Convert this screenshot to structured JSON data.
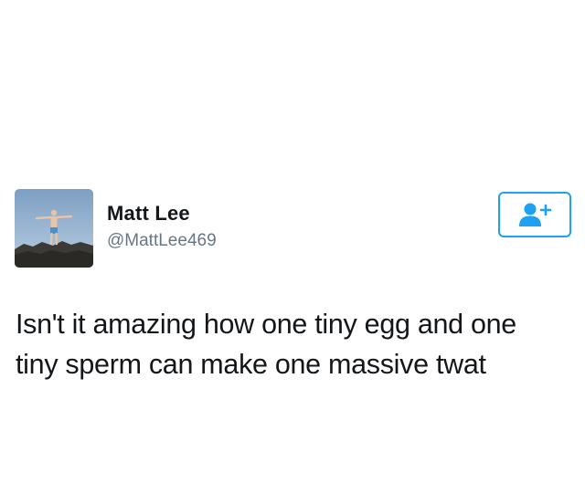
{
  "tweet": {
    "author": {
      "display_name": "Matt Lee",
      "handle": "@MattLee469",
      "avatar_icon": "profile-photo-person-on-rocks"
    },
    "follow_button": {
      "icon": "add-user-icon",
      "color": "#1da1f2"
    },
    "text_lines": [
      "Isn't it amazing how one tiny egg and one",
      "tiny sperm can make one massive twat"
    ]
  },
  "colors": {
    "name": "#14171a",
    "handle": "#657786",
    "accent": "#1da1f2",
    "background": "#ffffff"
  }
}
